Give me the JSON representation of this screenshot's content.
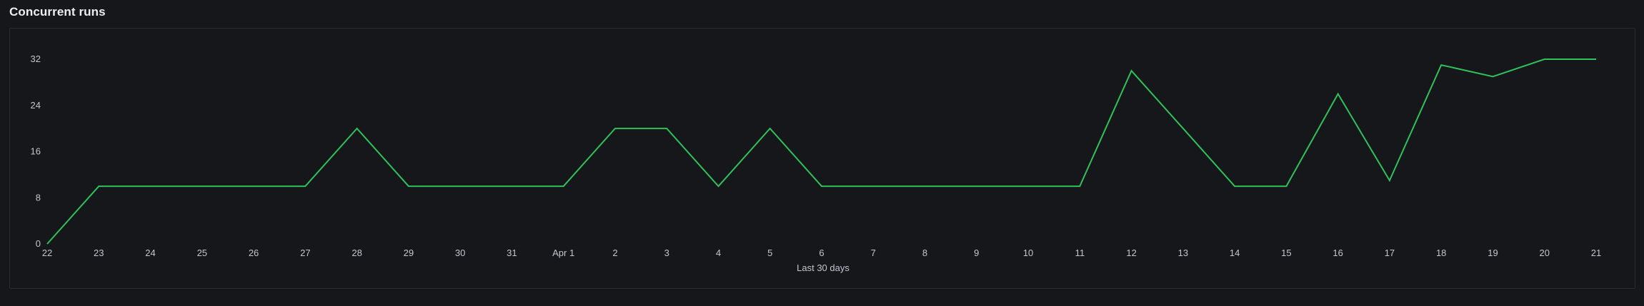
{
  "page": {
    "title": "Concurrent runs"
  },
  "chart_data": {
    "type": "line",
    "title": "Concurrent runs",
    "xlabel": "Last 30 days",
    "ylabel": "",
    "ylim": [
      0,
      32
    ],
    "yticks": [
      0,
      8,
      16,
      24,
      32
    ],
    "grid": false,
    "categories": [
      "22",
      "23",
      "24",
      "25",
      "26",
      "27",
      "28",
      "29",
      "30",
      "31",
      "Apr 1",
      "2",
      "3",
      "4",
      "5",
      "6",
      "7",
      "8",
      "9",
      "10",
      "11",
      "12",
      "13",
      "14",
      "15",
      "16",
      "17",
      "18",
      "19",
      "20",
      "21"
    ],
    "series": [
      {
        "color": "#2fc15a",
        "values": [
          0,
          10,
          10,
          10,
          10,
          10,
          20,
          10,
          10,
          10,
          10,
          20,
          20,
          10,
          20,
          10,
          10,
          10,
          10,
          10,
          10,
          30,
          20,
          10,
          10,
          26,
          11,
          31,
          29,
          32,
          32
        ]
      }
    ]
  }
}
